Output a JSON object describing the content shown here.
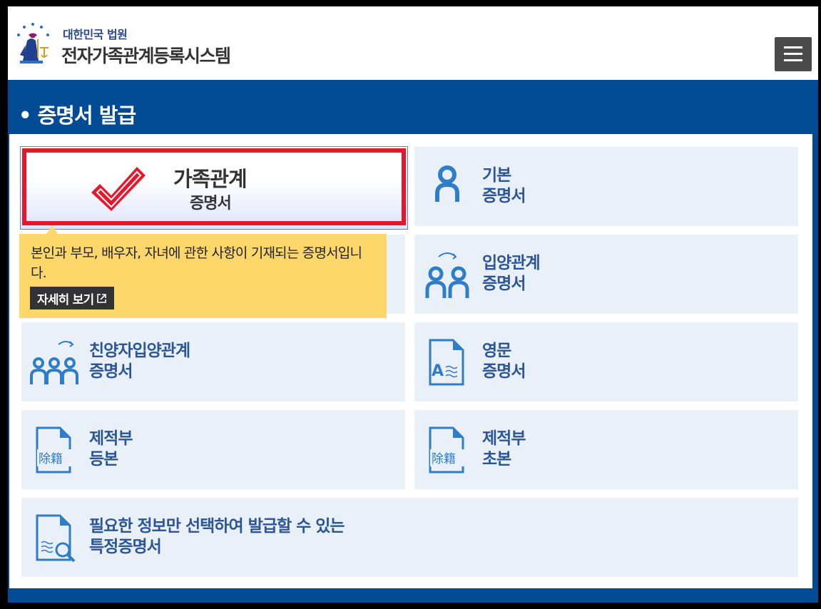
{
  "header": {
    "org_name": "대한민국 법원",
    "system_name": "전자가족관계등록시스템",
    "logo_icon": "court-emblem-icon",
    "menu_icon": "hamburger-icon"
  },
  "page": {
    "title": "• 증명서 발급"
  },
  "selected_card": {
    "title": "가족관계",
    "subtitle": "증명서",
    "icon": "check-mark-icon",
    "outline_color": "#e8162b"
  },
  "tooltip": {
    "text": "본인과 부모, 배우자, 자녀에 관한 사항이 기재되는 증명서입니다.",
    "more_label": "자세히 보기",
    "more_icon": "external-link-icon",
    "background": "#fdd76a"
  },
  "cards": [
    {
      "key": "basic",
      "line1": "기본",
      "line2": "증명서",
      "icon": "person-icon"
    },
    {
      "key": "adoption",
      "line1": "입양관계",
      "line2": "증명서",
      "icon": "two-persons-swap-icon"
    },
    {
      "key": "biological-adoption",
      "line1": "친양자입양관계",
      "line2": "증명서",
      "icon": "three-persons-swap-icon"
    },
    {
      "key": "english",
      "line1": "영문",
      "line2": "증명서",
      "icon": "english-document-icon"
    },
    {
      "key": "removed-register-full",
      "line1": "제적부",
      "line2": "등본",
      "icon": "removed-register-document-icon"
    },
    {
      "key": "removed-register-abstract",
      "line1": "제적부",
      "line2": "초본",
      "icon": "removed-register-document-icon"
    },
    {
      "key": "specific",
      "line1": "필요한 정보만 선택하여 발급할 수 있는",
      "line2": "특정증명서",
      "icon": "document-search-icon"
    }
  ],
  "colors": {
    "band": "#004b93",
    "card": "#eaf0f8",
    "card_text": "#2c5597",
    "icon": "#2f7dc8"
  }
}
